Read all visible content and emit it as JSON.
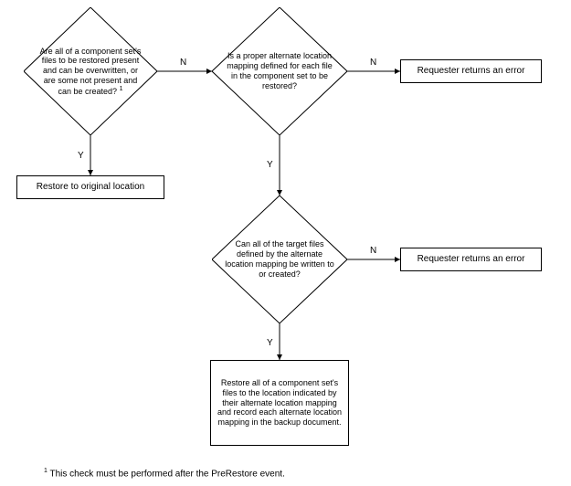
{
  "diamonds": {
    "d1": "Are all of a component set's files to be restored present and can be overwritten, or are some not present and can be created?",
    "d1_super": "1",
    "d2": "Is a proper alternate location mapping defined for each file in the component set to be restored?",
    "d3": "Can all of the target files defined by the alternate location mapping be written to or created?"
  },
  "boxes": {
    "b1": "Restore to original location",
    "b2": "Requester returns an error",
    "b3": "Requester returns an error",
    "b4": "Restore all of a component set's files to the location indicated by their alternate location mapping and record each alternate location mapping in the backup document."
  },
  "labels": {
    "n": "N",
    "y": "Y"
  },
  "footnote_super": "1",
  "footnote": " This check must be performed after the PreRestore event.",
  "colors": {
    "line": "#000000"
  },
  "chart_data": {
    "type": "table",
    "diagram": "flowchart",
    "nodes": [
      {
        "id": "d1",
        "type": "decision",
        "text": "Are all of a component set's files to be restored present and can be overwritten, or are some not present and can be created? [1]"
      },
      {
        "id": "b1",
        "type": "process",
        "text": "Restore to original location"
      },
      {
        "id": "d2",
        "type": "decision",
        "text": "Is a proper alternate location mapping defined for each file in the component set to be restored?"
      },
      {
        "id": "b2",
        "type": "process",
        "text": "Requester returns an error"
      },
      {
        "id": "d3",
        "type": "decision",
        "text": "Can all of the target files defined by the alternate location mapping be written to or created?"
      },
      {
        "id": "b3",
        "type": "process",
        "text": "Requester returns an error"
      },
      {
        "id": "b4",
        "type": "process",
        "text": "Restore all of a component set's files to the location indicated by their alternate location mapping and record each alternate location mapping in the backup document."
      }
    ],
    "edges": [
      {
        "from": "d1",
        "to": "b1",
        "label": "Y"
      },
      {
        "from": "d1",
        "to": "d2",
        "label": "N"
      },
      {
        "from": "d2",
        "to": "b2",
        "label": "N"
      },
      {
        "from": "d2",
        "to": "d3",
        "label": "Y"
      },
      {
        "from": "d3",
        "to": "b3",
        "label": "N"
      },
      {
        "from": "d3",
        "to": "b4",
        "label": "Y"
      }
    ],
    "footnote": "[1] This check must be performed after the PreRestore event."
  }
}
